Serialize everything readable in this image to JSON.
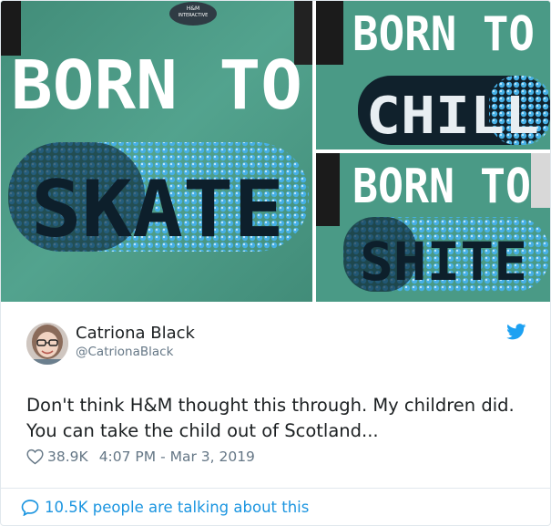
{
  "photos": {
    "tag": "H&M",
    "tag_sub": "INTERACTIVE",
    "born_to": "BORN TO",
    "main_word": "SKATE",
    "top_right_word": "CHILL",
    "bottom_right_word": "SHITE"
  },
  "author": {
    "name": "Catriona Black",
    "handle": "@CatrionaBlack"
  },
  "tweet": {
    "text": "Don't think H&M thought this through. My children did. You can take the child out of Scotland..."
  },
  "meta": {
    "likes": "38.9K",
    "timestamp": "4:07 PM - Mar 3, 2019"
  },
  "footer": {
    "talking": "10.5K people are talking about this"
  },
  "icons": {
    "bird": "twitter-bird-icon",
    "heart": "heart-outline-icon",
    "bubble": "speech-bubble-icon"
  },
  "colors": {
    "shirt_green": "#4a9a86",
    "sequin_blue": "#3aa3dc",
    "twitter_blue": "#1b95e0",
    "muted_text": "#657786"
  }
}
